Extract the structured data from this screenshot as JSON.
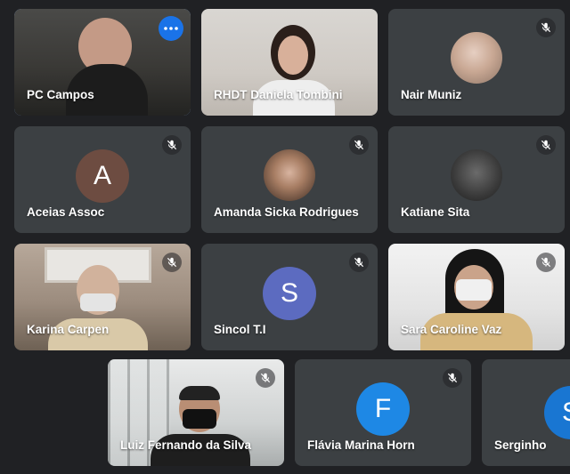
{
  "participants": [
    {
      "name": "PC Campos",
      "muted": false,
      "active": true,
      "more_icon": "more-horizontal-icon"
    },
    {
      "name": "RHDT Daniela Tombini",
      "muted": false
    },
    {
      "name": "Nair Muniz",
      "muted": true,
      "avatar_type": "photo"
    },
    {
      "name": "Aceias Assoc",
      "muted": true,
      "avatar_letter": "A",
      "avatar_color": "#6d4c41"
    },
    {
      "name": "Amanda Sicka Rodrigues",
      "muted": true,
      "avatar_type": "photo"
    },
    {
      "name": "Katiane Sita",
      "muted": true,
      "avatar_type": "photo"
    },
    {
      "name": "Karina Carpen",
      "muted": true
    },
    {
      "name": "Sincol T.I",
      "muted": true,
      "avatar_letter": "S",
      "avatar_color": "#5c6bc0"
    },
    {
      "name": "Sara Caroline Vaz",
      "muted": true
    },
    {
      "name": "Luiz Fernando da Silva",
      "muted": true
    },
    {
      "name": "Flávia Marina Horn",
      "muted": true,
      "avatar_letter": "F",
      "avatar_color": "#1e88e5"
    },
    {
      "name": "Serginho",
      "muted": false,
      "avatar_letter": "S",
      "avatar_color": "#1976d2"
    }
  ],
  "icons": {
    "muted": "mic-off-icon",
    "more": "more-options-icon"
  },
  "colors": {
    "background": "#202124",
    "tile": "#3c4043",
    "active_border": "#8ab4f8"
  }
}
